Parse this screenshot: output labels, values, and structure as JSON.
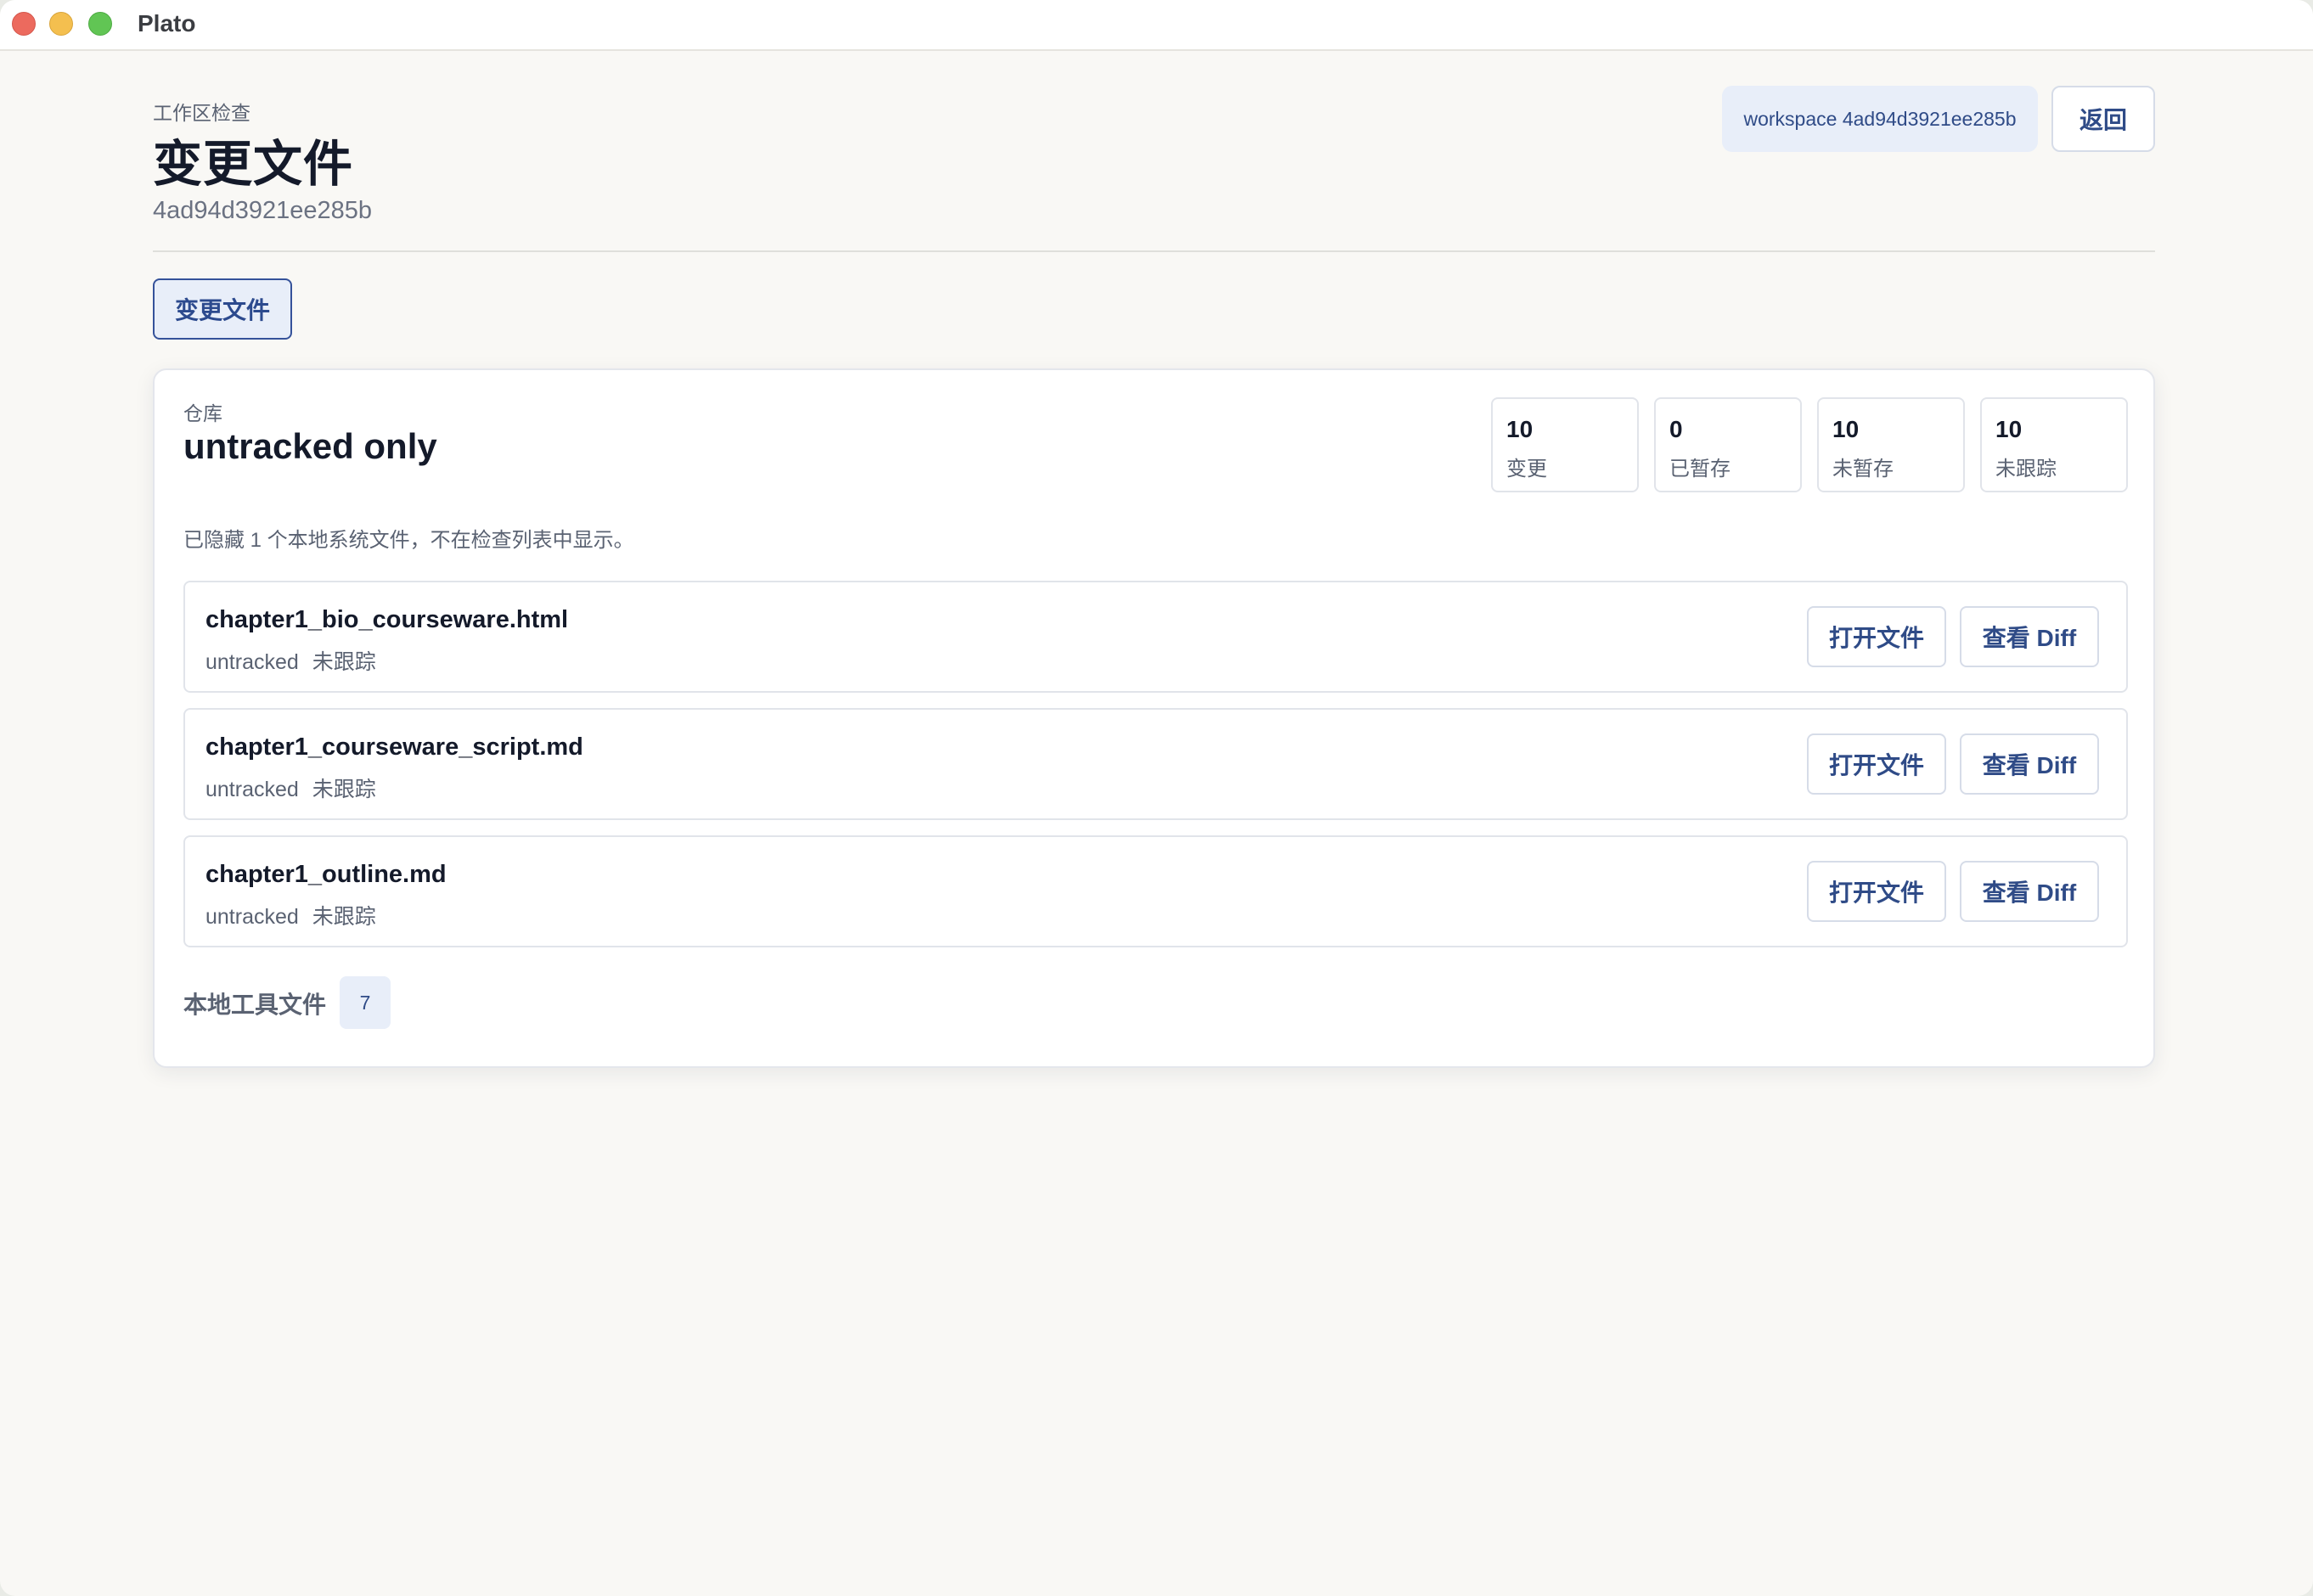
{
  "window": {
    "app_title": "Plato"
  },
  "header": {
    "kicker": "工作区检查",
    "title": "变更文件",
    "subtitle": "4ad94d3921ee285b",
    "workspace_pill": "workspace 4ad94d3921ee285b",
    "back_label": "返回"
  },
  "tabs": [
    {
      "label": "变更文件",
      "active": true
    }
  ],
  "repo": {
    "kicker": "仓库",
    "title": "untracked only",
    "stats": [
      {
        "value": "10",
        "label": "变更"
      },
      {
        "value": "0",
        "label": "已暂存"
      },
      {
        "value": "10",
        "label": "未暂存"
      },
      {
        "value": "10",
        "label": "未跟踪"
      }
    ],
    "hidden_note": "已隐藏 1 个本地系统文件，不在检查列表中显示。",
    "files": [
      {
        "name": "chapter1_bio_courseware.html",
        "status": "untracked",
        "status_label": "未跟踪",
        "open_label": "打开文件",
        "diff_label": "查看 Diff"
      },
      {
        "name": "chapter1_courseware_script.md",
        "status": "untracked",
        "status_label": "未跟踪",
        "open_label": "打开文件",
        "diff_label": "查看 Diff"
      },
      {
        "name": "chapter1_outline.md",
        "status": "untracked",
        "status_label": "未跟踪",
        "open_label": "打开文件",
        "diff_label": "查看 Diff"
      }
    ],
    "tools_label": "本地工具文件",
    "tools_count": "7"
  },
  "colors": {
    "accent": "#2f4b87",
    "accent_bg": "#e8eef9",
    "background": "#f9f8f5",
    "close": "#ec6a5e",
    "minimize": "#f4bf4f",
    "zoom": "#61c554"
  }
}
